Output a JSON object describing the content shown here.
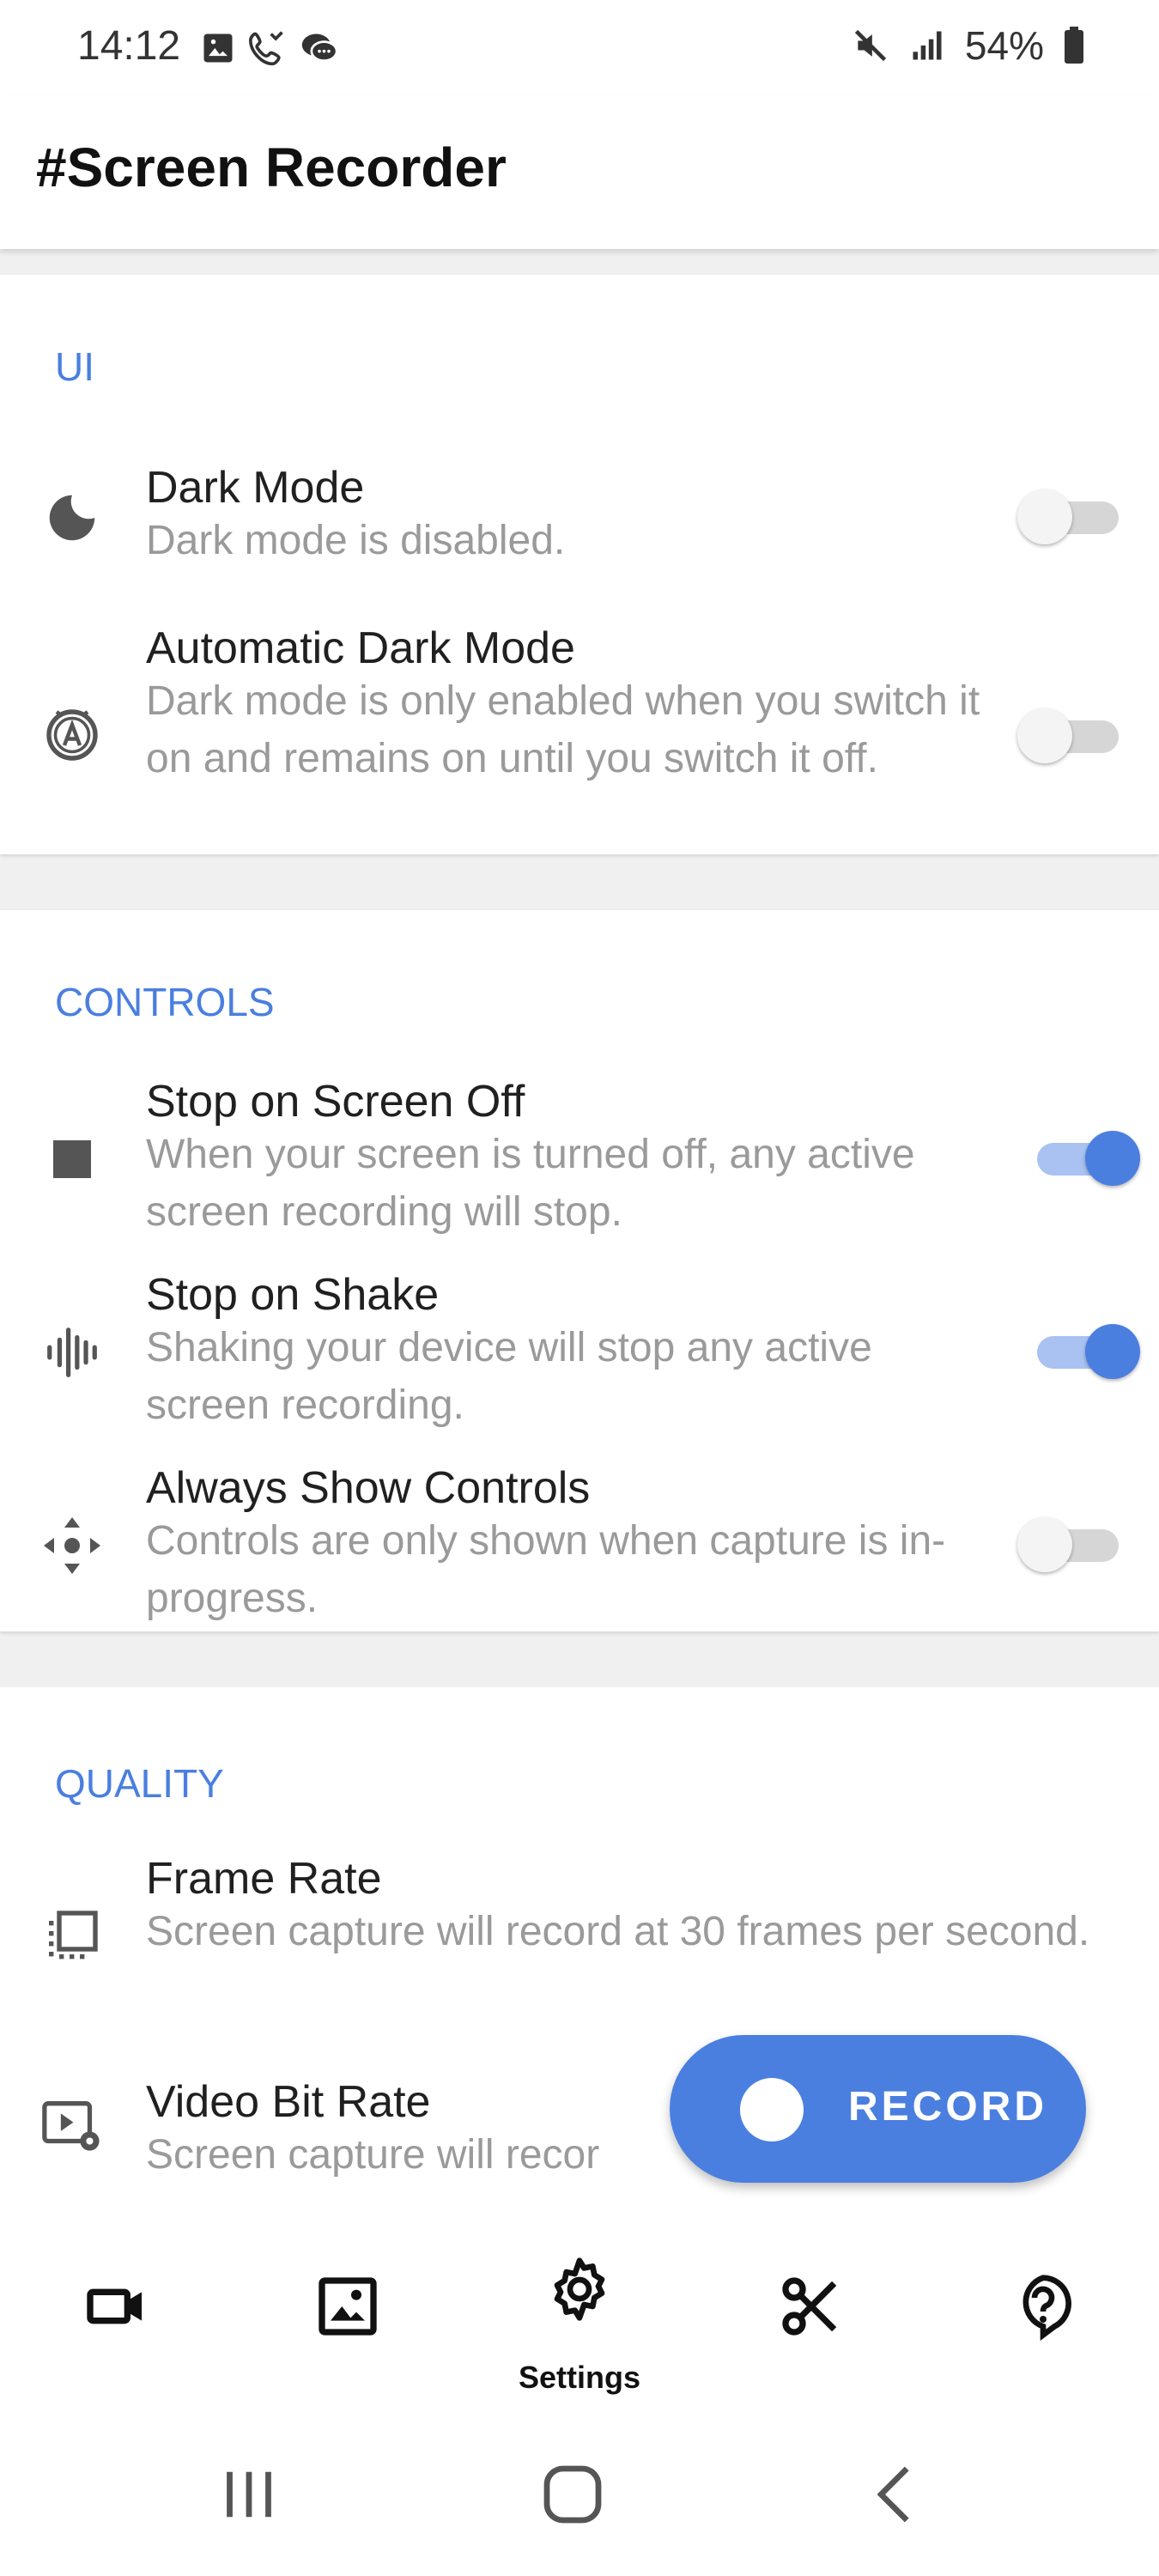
{
  "status": {
    "time": "14:12",
    "battery": "54%"
  },
  "app": {
    "title": "#Screen Recorder"
  },
  "sections": {
    "ui": {
      "header": "UI",
      "dark_mode": {
        "title": "Dark Mode",
        "subtitle": "Dark mode is disabled.",
        "on": false
      },
      "auto_dark_mode": {
        "title": "Automatic Dark Mode",
        "subtitle": "Dark mode is only enabled when you switch it on and remains on until you switch it off.",
        "on": false
      }
    },
    "controls": {
      "header": "CONTROLS",
      "stop_screen_off": {
        "title": "Stop on Screen Off",
        "subtitle": "When your screen is turned off, any active screen recording will stop.",
        "on": true
      },
      "stop_shake": {
        "title": "Stop on Shake",
        "subtitle": "Shaking your device will stop any active screen recording.",
        "on": true
      },
      "always_show": {
        "title": "Always Show Controls",
        "subtitle": "Controls are only shown when capture is in-progress.",
        "on": false
      }
    },
    "quality": {
      "header": "QUALITY",
      "frame_rate": {
        "title": "Frame Rate",
        "subtitle": "Screen capture will record at 30 frames per second."
      },
      "bit_rate": {
        "title": "Video Bit Rate",
        "subtitle": "Screen capture will recor"
      }
    }
  },
  "fab": {
    "label": "RECORD"
  },
  "bottom_nav": {
    "items": [
      {
        "icon": "video-camera-icon",
        "label": ""
      },
      {
        "icon": "gallery-icon",
        "label": ""
      },
      {
        "icon": "gear-icon",
        "label": "Settings",
        "active": true
      },
      {
        "icon": "scissors-icon",
        "label": ""
      },
      {
        "icon": "help-icon",
        "label": ""
      }
    ]
  },
  "colors": {
    "accent": "#4a7fe0",
    "accent_light": "#a9c2f2",
    "background": "#f0f0f0"
  }
}
